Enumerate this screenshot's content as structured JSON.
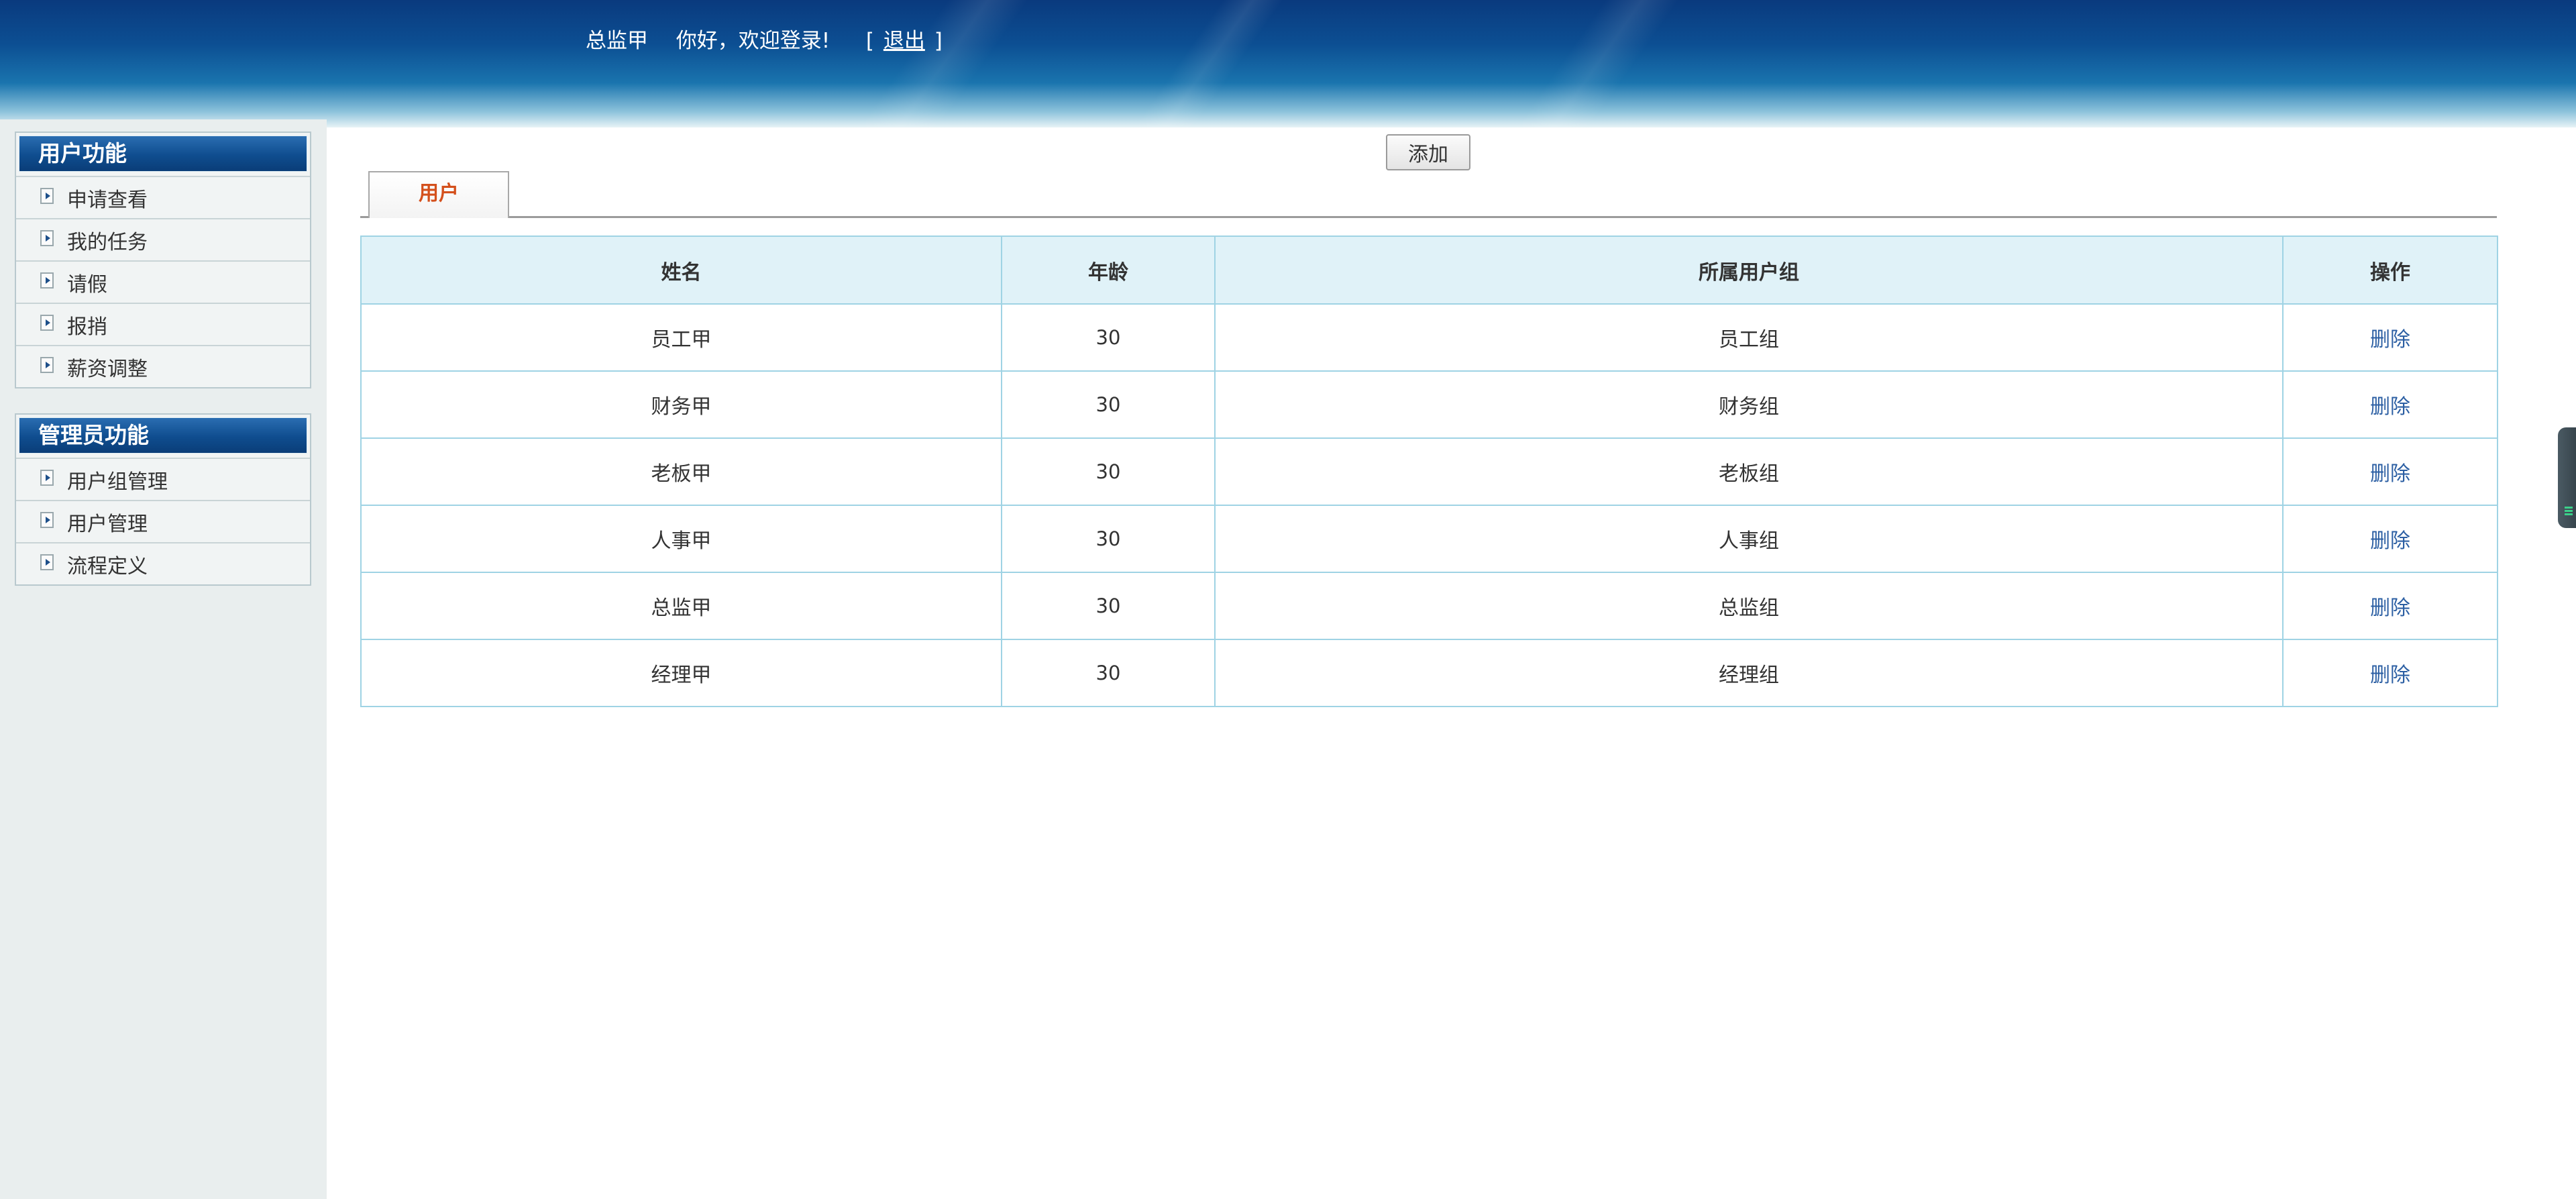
{
  "header": {
    "user_name": "总监甲",
    "greeting": "你好，欢迎登录!",
    "bracket_open": "[",
    "logout_label": "退出",
    "bracket_close": "]"
  },
  "sidebar": {
    "groups": [
      {
        "title": "用户功能",
        "items": [
          "申请查看",
          "我的任务",
          "请假",
          "报捎",
          "薪资调整"
        ]
      },
      {
        "title": "管理员功能",
        "items": [
          "用户组管理",
          "用户管理",
          "流程定义"
        ]
      }
    ]
  },
  "toolbar": {
    "add_label": "添加"
  },
  "tabs": [
    {
      "label": "用户",
      "active": true
    }
  ],
  "table": {
    "columns": [
      "姓名",
      "年龄",
      "所属用户组",
      "操作"
    ],
    "rows": [
      {
        "name": "员工甲",
        "age": "30",
        "group": "员工组",
        "action": "删除"
      },
      {
        "name": "财务甲",
        "age": "30",
        "group": "财务组",
        "action": "删除"
      },
      {
        "name": "老板甲",
        "age": "30",
        "group": "老板组",
        "action": "删除"
      },
      {
        "name": "人事甲",
        "age": "30",
        "group": "人事组",
        "action": "删除"
      },
      {
        "name": "总监甲",
        "age": "30",
        "group": "总监组",
        "action": "删除"
      },
      {
        "name": "经理甲",
        "age": "30",
        "group": "经理组",
        "action": "删除"
      }
    ]
  },
  "colors": {
    "header_dark": "#0a3a7e",
    "tab_active_text": "#d4501c",
    "table_header_bg": "#e0f2f8",
    "table_border": "#9fd3e4",
    "link": "#2c5fa3"
  }
}
